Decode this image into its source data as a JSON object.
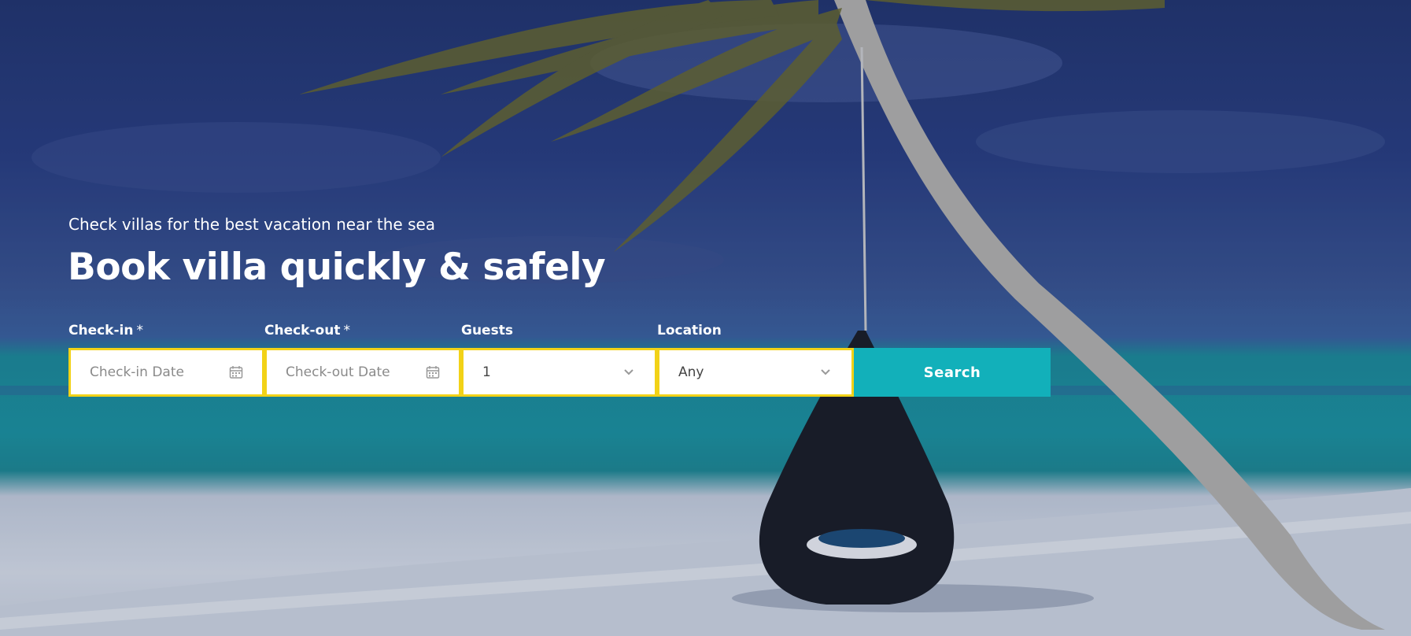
{
  "hero": {
    "tagline": "Check villas for the best vacation near the sea",
    "headline": "Book villa quickly & safely"
  },
  "form": {
    "checkin": {
      "label": "Check-in",
      "required_mark": "*",
      "placeholder": "Check-in Date",
      "icon": "calendar-icon"
    },
    "checkout": {
      "label": "Check-out",
      "required_mark": "*",
      "placeholder": "Check-out Date",
      "icon": "calendar-icon"
    },
    "guests": {
      "label": "Guests",
      "value": "1",
      "icon": "chevron-down-icon"
    },
    "location": {
      "label": "Location",
      "value": "Any",
      "icon": "chevron-down-icon"
    },
    "search_label": "Search"
  },
  "colors": {
    "field_border": "#f2d217",
    "search_button": "#12b0ba",
    "text_on_hero": "#ffffff"
  }
}
